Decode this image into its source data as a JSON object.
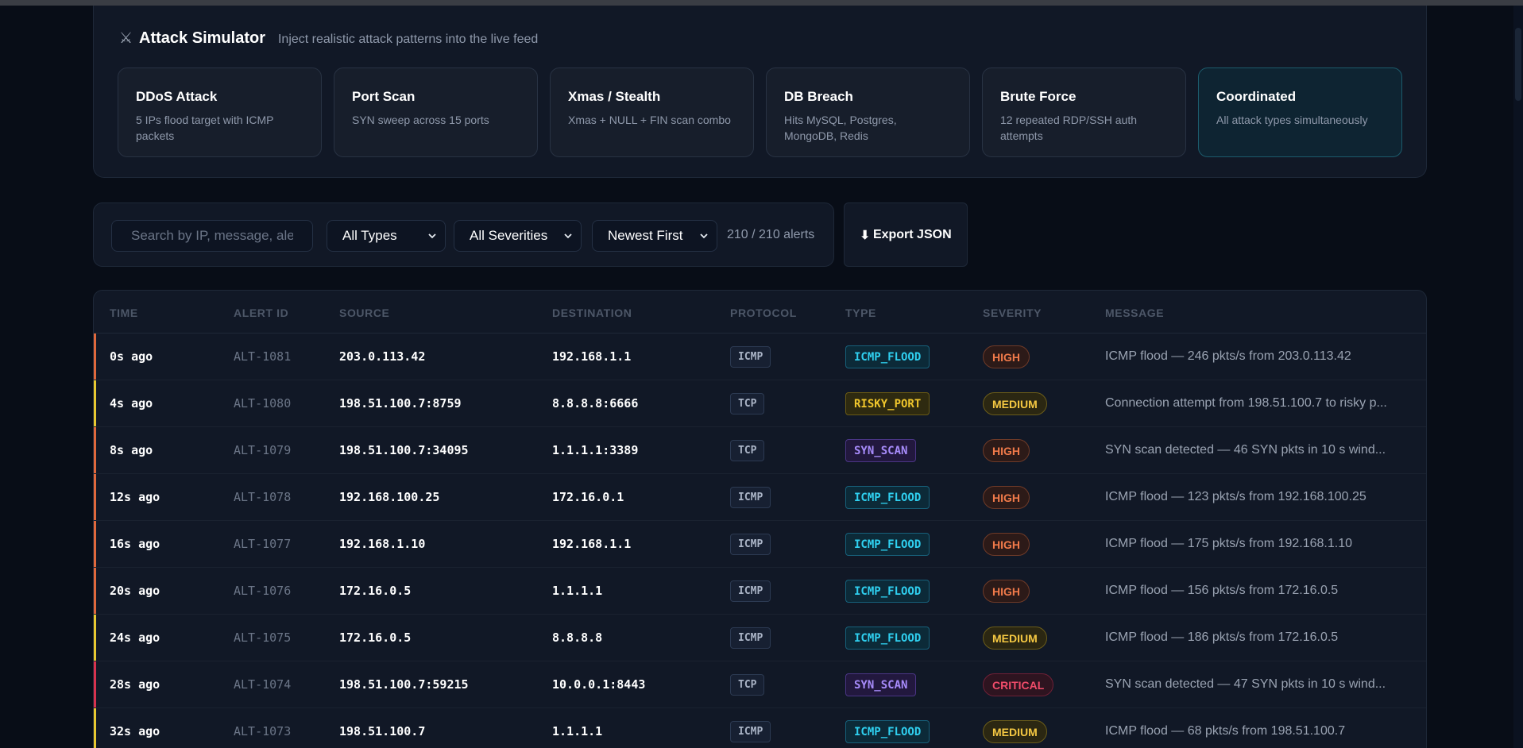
{
  "simulator": {
    "icon": "crossed-swords-icon",
    "title": "Attack Simulator",
    "subtitle": "Inject realistic attack patterns into the live feed",
    "cards": [
      {
        "title": "DDoS Attack",
        "desc": "5 IPs flood target with ICMP packets",
        "active": false
      },
      {
        "title": "Port Scan",
        "desc": "SYN sweep across 15 ports",
        "active": false
      },
      {
        "title": "Xmas / Stealth",
        "desc": "Xmas + NULL + FIN scan combo",
        "active": false
      },
      {
        "title": "DB Breach",
        "desc": "Hits MySQL, Postgres, MongoDB, Redis",
        "active": false
      },
      {
        "title": "Brute Force",
        "desc": "12 repeated RDP/SSH auth attempts",
        "active": false
      },
      {
        "title": "Coordinated",
        "desc": "All attack types simultaneously",
        "active": true
      }
    ]
  },
  "filters": {
    "search_placeholder": "Search by IP, message, alert ID",
    "type_select": "All Types",
    "severity_select": "All Severities",
    "sort_select": "Newest First",
    "count": "210 / 210 alerts",
    "export_icon": "download-arrow-icon",
    "export_label": "Export JSON"
  },
  "table": {
    "headers": [
      "TIME",
      "ALERT ID",
      "SOURCE",
      "DESTINATION",
      "PROTOCOL",
      "TYPE",
      "SEVERITY",
      "MESSAGE"
    ],
    "rows": [
      {
        "time": "0s ago",
        "id": "ALT-1081",
        "src": "203.0.113.42",
        "dst": "192.168.1.1",
        "proto": "ICMP",
        "type": "ICMP_FLOOD",
        "sev": "HIGH",
        "msg": "ICMP flood — 246 pkts/s from 203.0.113.42"
      },
      {
        "time": "4s ago",
        "id": "ALT-1080",
        "src": "198.51.100.7:8759",
        "dst": "8.8.8.8:6666",
        "proto": "TCP",
        "type": "RISKY_PORT",
        "sev": "MEDIUM",
        "msg": "Connection attempt from 198.51.100.7 to risky p..."
      },
      {
        "time": "8s ago",
        "id": "ALT-1079",
        "src": "198.51.100.7:34095",
        "dst": "1.1.1.1:3389",
        "proto": "TCP",
        "type": "SYN_SCAN",
        "sev": "HIGH",
        "msg": "SYN scan detected — 46 SYN pkts in 10 s wind..."
      },
      {
        "time": "12s ago",
        "id": "ALT-1078",
        "src": "192.168.100.25",
        "dst": "172.16.0.1",
        "proto": "ICMP",
        "type": "ICMP_FLOOD",
        "sev": "HIGH",
        "msg": "ICMP flood — 123 pkts/s from 192.168.100.25"
      },
      {
        "time": "16s ago",
        "id": "ALT-1077",
        "src": "192.168.1.10",
        "dst": "192.168.1.1",
        "proto": "ICMP",
        "type": "ICMP_FLOOD",
        "sev": "HIGH",
        "msg": "ICMP flood — 175 pkts/s from 192.168.1.10"
      },
      {
        "time": "20s ago",
        "id": "ALT-1076",
        "src": "172.16.0.5",
        "dst": "1.1.1.1",
        "proto": "ICMP",
        "type": "ICMP_FLOOD",
        "sev": "HIGH",
        "msg": "ICMP flood — 156 pkts/s from 172.16.0.5"
      },
      {
        "time": "24s ago",
        "id": "ALT-1075",
        "src": "172.16.0.5",
        "dst": "8.8.8.8",
        "proto": "ICMP",
        "type": "ICMP_FLOOD",
        "sev": "MEDIUM",
        "msg": "ICMP flood — 186 pkts/s from 172.16.0.5"
      },
      {
        "time": "28s ago",
        "id": "ALT-1074",
        "src": "198.51.100.7:59215",
        "dst": "10.0.0.1:8443",
        "proto": "TCP",
        "type": "SYN_SCAN",
        "sev": "CRITICAL",
        "msg": "SYN scan detected — 47 SYN pkts in 10 s wind..."
      },
      {
        "time": "32s ago",
        "id": "ALT-1073",
        "src": "198.51.100.7",
        "dst": "1.1.1.1",
        "proto": "ICMP",
        "type": "ICMP_FLOOD",
        "sev": "MEDIUM",
        "msg": "ICMP flood — 68 pkts/s from 198.51.100.7"
      }
    ]
  },
  "colors": {
    "type": {
      "ICMP_FLOOD": {
        "fg": "#2fd0f0",
        "bg": "#0c2a38",
        "border": "#17607a"
      },
      "RISKY_PORT": {
        "fg": "#f0c62c",
        "bg": "#2e2a10",
        "border": "#6a5a14"
      },
      "SYN_SCAN": {
        "fg": "#a78bfa",
        "bg": "#22183e",
        "border": "#4a3585"
      }
    },
    "severity": {
      "HIGH": {
        "fg": "#f07a4a",
        "bg": "#2c1a18",
        "border": "#6e3a28",
        "bar": "#e0683c"
      },
      "MEDIUM": {
        "fg": "#f5c842",
        "bg": "#2b2712",
        "border": "#6a5c1a",
        "bar": "#e8c830"
      },
      "CRITICAL": {
        "fg": "#f04c6a",
        "bg": "#2e1420",
        "border": "#6e2036",
        "bar": "#d8324e"
      }
    }
  }
}
